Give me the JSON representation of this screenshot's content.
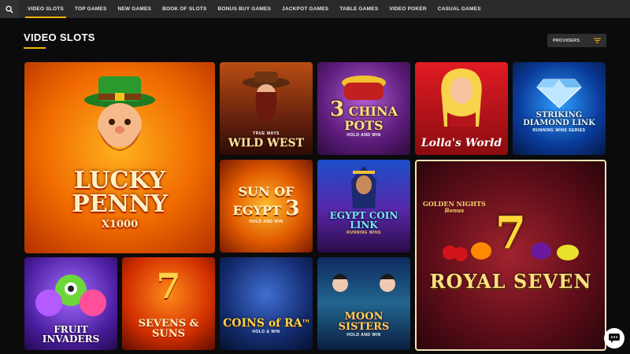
{
  "nav": {
    "items": [
      {
        "label": "VIDEO SLOTS",
        "active": true
      },
      {
        "label": "TOP GAMES"
      },
      {
        "label": "NEW GAMES"
      },
      {
        "label": "BOOK OF SLOTS"
      },
      {
        "label": "BONUS BUY GAMES"
      },
      {
        "label": "JACKPOT GAMES"
      },
      {
        "label": "TABLE GAMES"
      },
      {
        "label": "VIDEO POKER"
      },
      {
        "label": "CASUAL GAMES"
      }
    ],
    "accent": "#f0b400"
  },
  "page": {
    "title": "VIDEO SLOTS",
    "providers_label": "PROVIDERS"
  },
  "games": {
    "lucky_penny": {
      "line1": "LUCKY",
      "line2": "PENNY",
      "badge": "X1000"
    },
    "wild_west": {
      "tag": "TRUE WAYS",
      "name": "WILD WEST"
    },
    "china_pots": {
      "prefix": "3",
      "name": "CHINA POTS",
      "sub": "HOLD AND WIN"
    },
    "lollas_world": {
      "name": "Lolla's World"
    },
    "diamond_link": {
      "name": "STRIKING DIAMOND LINK",
      "sub": "RUNNING WINS SERIES"
    },
    "sun_egypt": {
      "name": "SUN OF EGYPT",
      "num": "3",
      "sub": "HOLD AND WIN"
    },
    "egypt_coin": {
      "name": "EGYPT COIN LINK",
      "sub": "RUNNING WINS"
    },
    "royal_seven": {
      "brand": "GOLDEN NIGHTS",
      "brand_sub": "Bonus",
      "seven": "7",
      "name": "ROYAL SEVEN"
    },
    "fruit_invaders": {
      "name": "FRUIT INVADERS"
    },
    "sevens_suns": {
      "seven": "7",
      "name": "SEVENS & SUNS"
    },
    "coins_ra": {
      "name": "COINS of RA",
      "tm": "TM",
      "sub": "HOLD & WIN"
    },
    "moon_sisters": {
      "name": "MOON SISTERS",
      "sub": "HOLD AND WIN"
    }
  }
}
